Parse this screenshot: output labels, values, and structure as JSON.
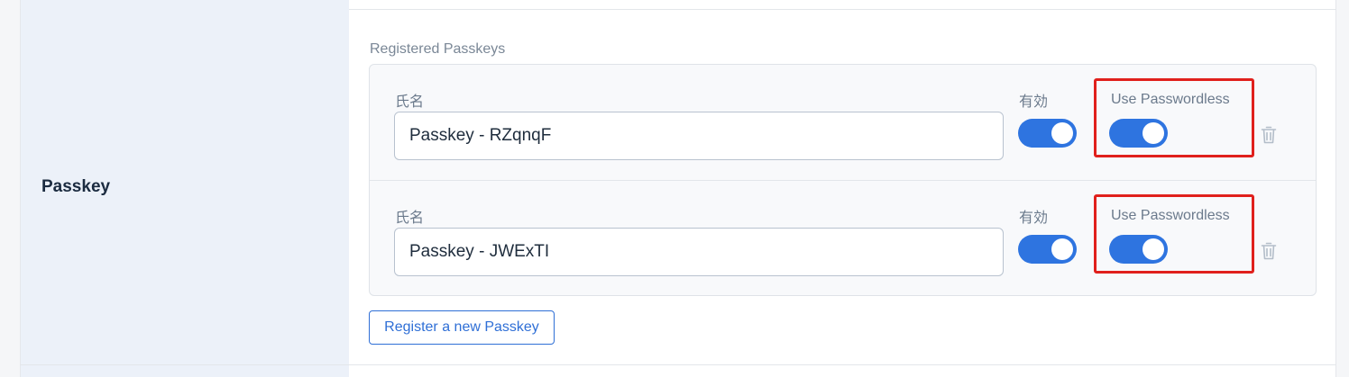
{
  "row": {
    "label": "Passkey"
  },
  "section": {
    "title": "Registered Passkeys"
  },
  "passkeys": [
    {
      "name_label": "氏名",
      "name_value": "Passkey - RZqnqF",
      "enabled_label": "有効",
      "enabled": true,
      "passwordless_label": "Use Passwordless",
      "passwordless": true
    },
    {
      "name_label": "氏名",
      "name_value": "Passkey - JWExTI",
      "enabled_label": "有効",
      "enabled": true,
      "passwordless_label": "Use Passwordless",
      "passwordless": true
    }
  ],
  "actions": {
    "register_label": "Register a new Passkey"
  },
  "colors": {
    "accent": "#2e74e0",
    "highlight": "#e0201c",
    "label_bg": "#ecf1f9"
  },
  "icons": {
    "delete": "trash-icon"
  }
}
